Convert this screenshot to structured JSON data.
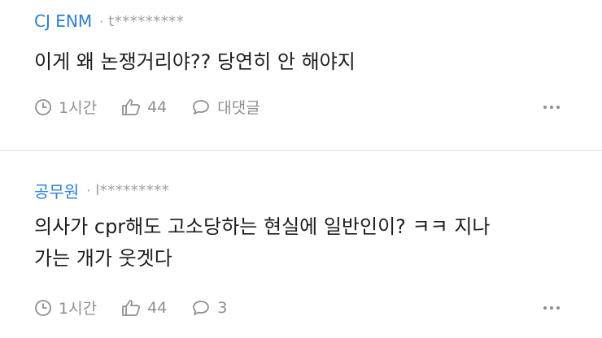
{
  "comments": [
    {
      "author": "CJ ENM",
      "dot": "·",
      "masked_id": "t*********",
      "text_lines": [
        "이게 왜 논쟁거리야?? 당연히 안 해야지"
      ],
      "time": "1시간",
      "likes": "44",
      "reply_label": "대댓글"
    },
    {
      "author": "공무원",
      "dot": "·",
      "masked_id": "l*********",
      "text_lines": [
        "의사가 cpr해도 고소당하는 현실에 일반인이? ㅋㅋ 지나",
        "가는 개가 웃겟다"
      ],
      "time": "1시간",
      "likes": "44",
      "reply_label": "3"
    }
  ],
  "colors": {
    "author": "#2a7fd4",
    "meta": "#8c8f93",
    "divider": "#ececec"
  }
}
